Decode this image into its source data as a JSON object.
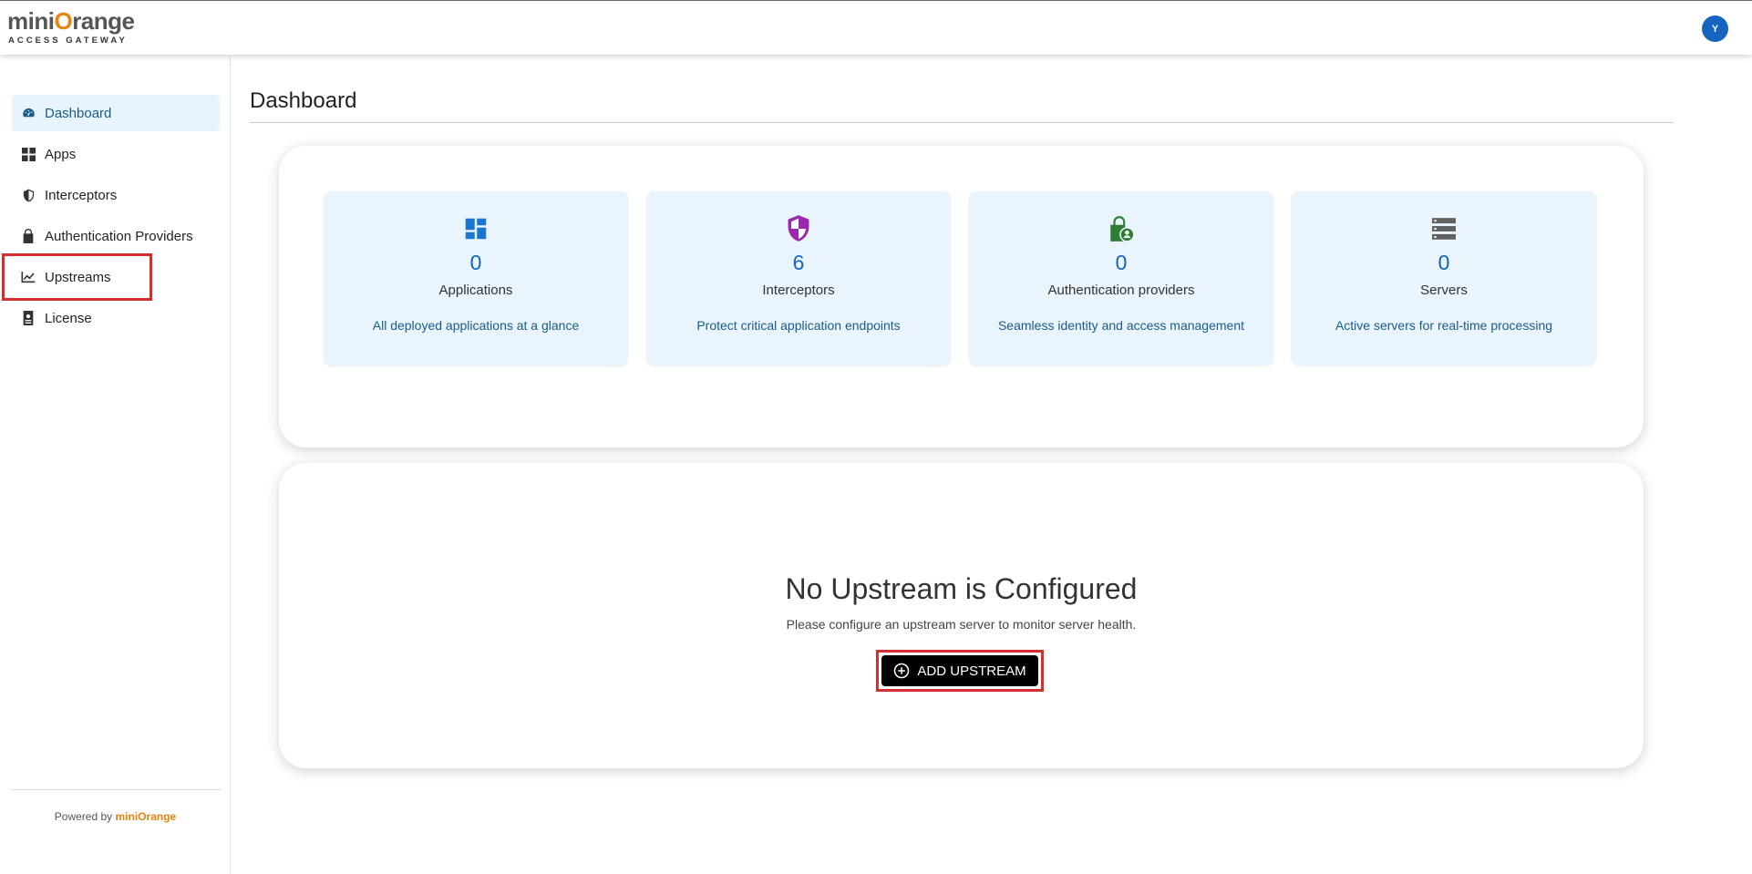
{
  "brand": {
    "logo_prefix": "mini",
    "logo_o": "O",
    "logo_suffix": "range",
    "logo_sub": "ACCESS GATEWAY"
  },
  "user": {
    "avatar_initial": "Y"
  },
  "sidebar": {
    "items": [
      {
        "label": "Dashboard",
        "icon": "dashboard-icon",
        "active": true
      },
      {
        "label": "Apps",
        "icon": "grid-icon"
      },
      {
        "label": "Interceptors",
        "icon": "shield-icon"
      },
      {
        "label": "Authentication Providers",
        "icon": "lock-icon"
      },
      {
        "label": "Upstreams",
        "icon": "chart-line-icon"
      },
      {
        "label": "License",
        "icon": "license-icon"
      }
    ],
    "powered_by_text": "Powered by",
    "powered_by_brand": "miniOrange"
  },
  "main": {
    "title": "Dashboard",
    "cards": [
      {
        "count": "0",
        "label": "Applications",
        "desc": "All deployed applications at a glance",
        "icon": "applications-icon",
        "color": "#1976d2"
      },
      {
        "count": "6",
        "label": "Interceptors",
        "desc": "Protect critical application endpoints",
        "icon": "shield-icon",
        "color": "#9c27b0"
      },
      {
        "count": "0",
        "label": "Authentication providers",
        "desc": "Seamless identity and access management",
        "icon": "lock-user-icon",
        "color": "#2e7d32"
      },
      {
        "count": "0",
        "label": "Servers",
        "desc": "Active servers for real-time processing",
        "icon": "servers-icon",
        "color": "#616161"
      }
    ],
    "empty_state": {
      "title": "No Upstream is Configured",
      "desc": "Please configure an upstream server to monitor server health.",
      "button_label": "ADD UPSTREAM"
    }
  },
  "colors": {
    "accent": "#1565c0",
    "brand_orange": "#e8830c",
    "highlight": "#d32f2f",
    "card_bg": "#e9f4fd"
  }
}
